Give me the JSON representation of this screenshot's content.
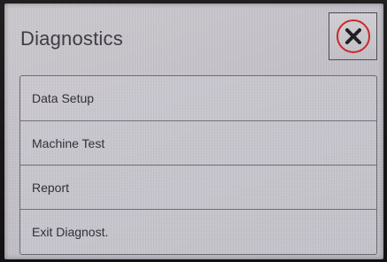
{
  "header": {
    "title": "Diagnostics"
  },
  "close_button": {
    "icon": "close-icon",
    "accent_color": "#c8262c"
  },
  "menu": {
    "items": [
      {
        "label": "Data Setup"
      },
      {
        "label": "Machine Test"
      },
      {
        "label": "Report"
      },
      {
        "label": "Exit Diagnost."
      }
    ]
  }
}
